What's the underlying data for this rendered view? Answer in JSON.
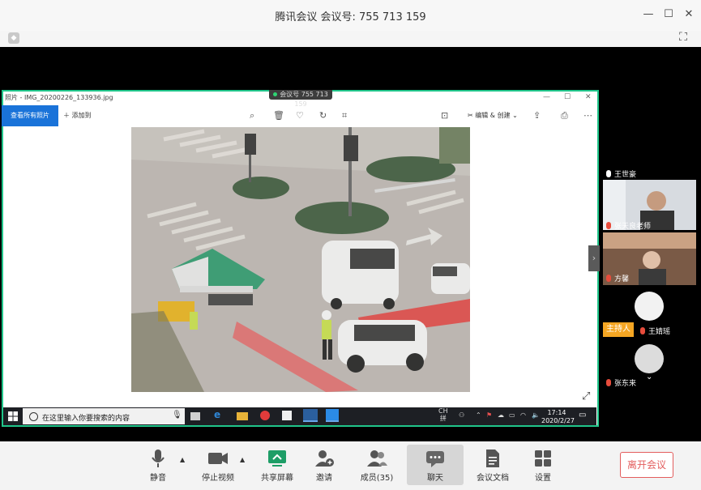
{
  "window": {
    "title": "腾讯会议 会议号: 755 713 159",
    "controls": [
      "minimize-icon",
      "maximize-icon",
      "close-icon"
    ],
    "fullscreen_icon": "fullscreen-icon",
    "shield_icon": "shield-icon"
  },
  "share": {
    "indicator": "会议号 755 713 159",
    "photo_title": "照片 - IMG_20200226_133936.jpg",
    "view_all": "查看所有照片",
    "add": "添加到",
    "edit": "编辑 & 创建",
    "tools": [
      "zoom-icon",
      "delete-icon",
      "heart-icon",
      "rotate-icon",
      "crop-icon"
    ],
    "taskbar": {
      "search_placeholder": "在这里输入你要搜索的内容",
      "ime": "CH",
      "ime2": "拼",
      "time": "17:14",
      "date": "2020/2/27"
    }
  },
  "participants": [
    {
      "name": "王世豪",
      "muted": false
    },
    {
      "name": "张天良老师",
      "muted": true
    },
    {
      "name": "方馨",
      "muted": true
    },
    {
      "name": "王婧瑶",
      "muted": true,
      "host": "主持人"
    },
    {
      "name": "张东来",
      "muted": true
    }
  ],
  "toolbar": {
    "mute": "静音",
    "stop_video": "停止视频",
    "share_screen": "共享屏幕",
    "invite": "邀请",
    "members": "成员(35)",
    "chat": "聊天",
    "docs": "会议文档",
    "settings": "设置",
    "leave": "离开会议"
  },
  "colors": {
    "share_border": "#20c58a",
    "accent_blue": "#1a73d9",
    "leave_red": "#e35d5d",
    "host_badge": "#f5a623"
  }
}
